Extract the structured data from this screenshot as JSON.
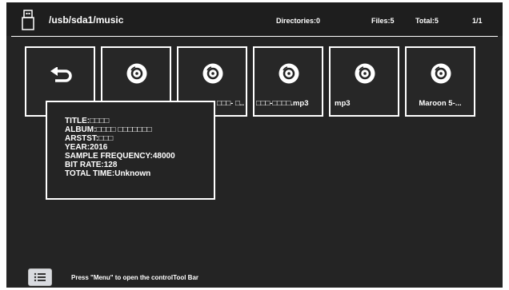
{
  "header": {
    "path": "/usb/sda1/music",
    "directories": "Directories:0",
    "files": "Files:5",
    "total": "Total:5",
    "page": "1/1"
  },
  "tiles": [
    {
      "name": "",
      "icon": "back-arrow-icon"
    },
    {
      "name": "",
      "icon": "disc-icon"
    },
    {
      "name": "□□□- □..",
      "icon": "disc-icon"
    },
    {
      "name": "□□□-□□□□.mp3",
      "icon": "disc-icon"
    },
    {
      "name": "mp3",
      "icon": "disc-icon"
    },
    {
      "name": "Maroon 5-...",
      "icon": "disc-icon"
    }
  ],
  "info": {
    "title": "TITLE:□□□□",
    "album": "ALBUM:□□□□ □□□□□□□",
    "artist": "ARSTST:□□□",
    "year": "YEAR:2016",
    "sample_frequency": "SAMPLE FREQUENCY:48000",
    "bit_rate": "BIT RATE:128",
    "total_time": "TOTAL TIME:Unknown"
  },
  "footer": {
    "hint": "Press \"Menu\" to open the controlTool Bar",
    "menu_icon": "menu-list-icon"
  },
  "colors": {
    "background": "#242424",
    "foreground": "#ffffff",
    "menu_button": "#d9dbe0"
  }
}
